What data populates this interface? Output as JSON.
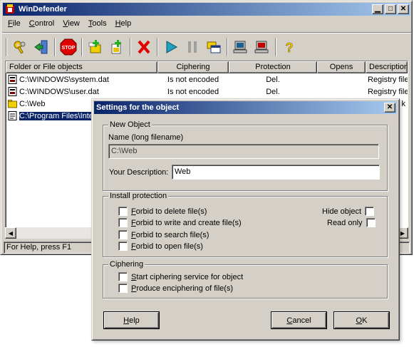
{
  "window": {
    "title": "WinDefender"
  },
  "menu": [
    {
      "key": "F",
      "rest": "ile"
    },
    {
      "key": "C",
      "rest": "ontrol"
    },
    {
      "key": "V",
      "rest": "iew"
    },
    {
      "key": "T",
      "rest": "ools"
    },
    {
      "key": "H",
      "rest": "elp"
    }
  ],
  "list": {
    "columns": [
      "Folder or File objects",
      "Ciphering",
      "Protection",
      "Opens",
      "Description"
    ],
    "rows": [
      {
        "path": "C:\\WINDOWS\\system.dat",
        "ciphering": "Is not encoded",
        "protection": "Del.",
        "opens": "",
        "description": "Registry file"
      },
      {
        "path": "C:\\WINDOWS\\user.dat",
        "ciphering": "Is not encoded",
        "protection": "Del.",
        "opens": "",
        "description": "Registry file"
      },
      {
        "path": "C:\\Web",
        "ciphering": "",
        "protection": "",
        "opens": "",
        "description": "k"
      },
      {
        "path": "C:\\Program Files\\Inte",
        "ciphering": "",
        "protection": "",
        "opens": "",
        "description": ""
      }
    ]
  },
  "status": {
    "text": "For Help, press F1"
  },
  "dialog": {
    "title": "Settings for the object",
    "new_object": {
      "legend": "New Object",
      "name_label": "Name (long filename)",
      "name_value": "C:\\Web",
      "description_label": "Your Description:",
      "description_value": "Web"
    },
    "install_protection": {
      "legend": "Install protection",
      "options": [
        {
          "key": "F",
          "rest": "orbid to delete file(s)",
          "checked": false
        },
        {
          "key": "F",
          "rest": "orbid to write and create file(s)",
          "checked": false
        },
        {
          "key": "F",
          "rest": "orbid to search file(s)",
          "checked": false
        },
        {
          "key": "F",
          "rest": "orbid to open file(s)",
          "checked": false
        }
      ],
      "hide_object_label": "Hide object",
      "read_only_label": "Read only"
    },
    "ciphering": {
      "legend": "Ciphering",
      "options": [
        {
          "key": "S",
          "rest": "tart ciphering service for object",
          "checked": false
        },
        {
          "key": "P",
          "rest": "roduce enciphering of file(s)",
          "checked": false
        }
      ]
    },
    "buttons": {
      "help": {
        "key": "H",
        "rest": "elp"
      },
      "cancel": {
        "key": "C",
        "rest": "ancel"
      },
      "ok": {
        "key": "O",
        "rest": "K"
      }
    }
  },
  "icons": {
    "toolbar": [
      "keys-icon",
      "login-door-icon",
      "stop-icon",
      "add-folder-icon",
      "add-file-icon",
      "delete-icon",
      "play-icon",
      "pause-icon",
      "folders-icon",
      "computer-icon",
      "computer-lock-icon",
      "help-icon"
    ],
    "colors": {
      "titlebar_start": "#0a246a",
      "titlebar_end": "#a6caf0",
      "face": "#d4d0c8"
    }
  }
}
